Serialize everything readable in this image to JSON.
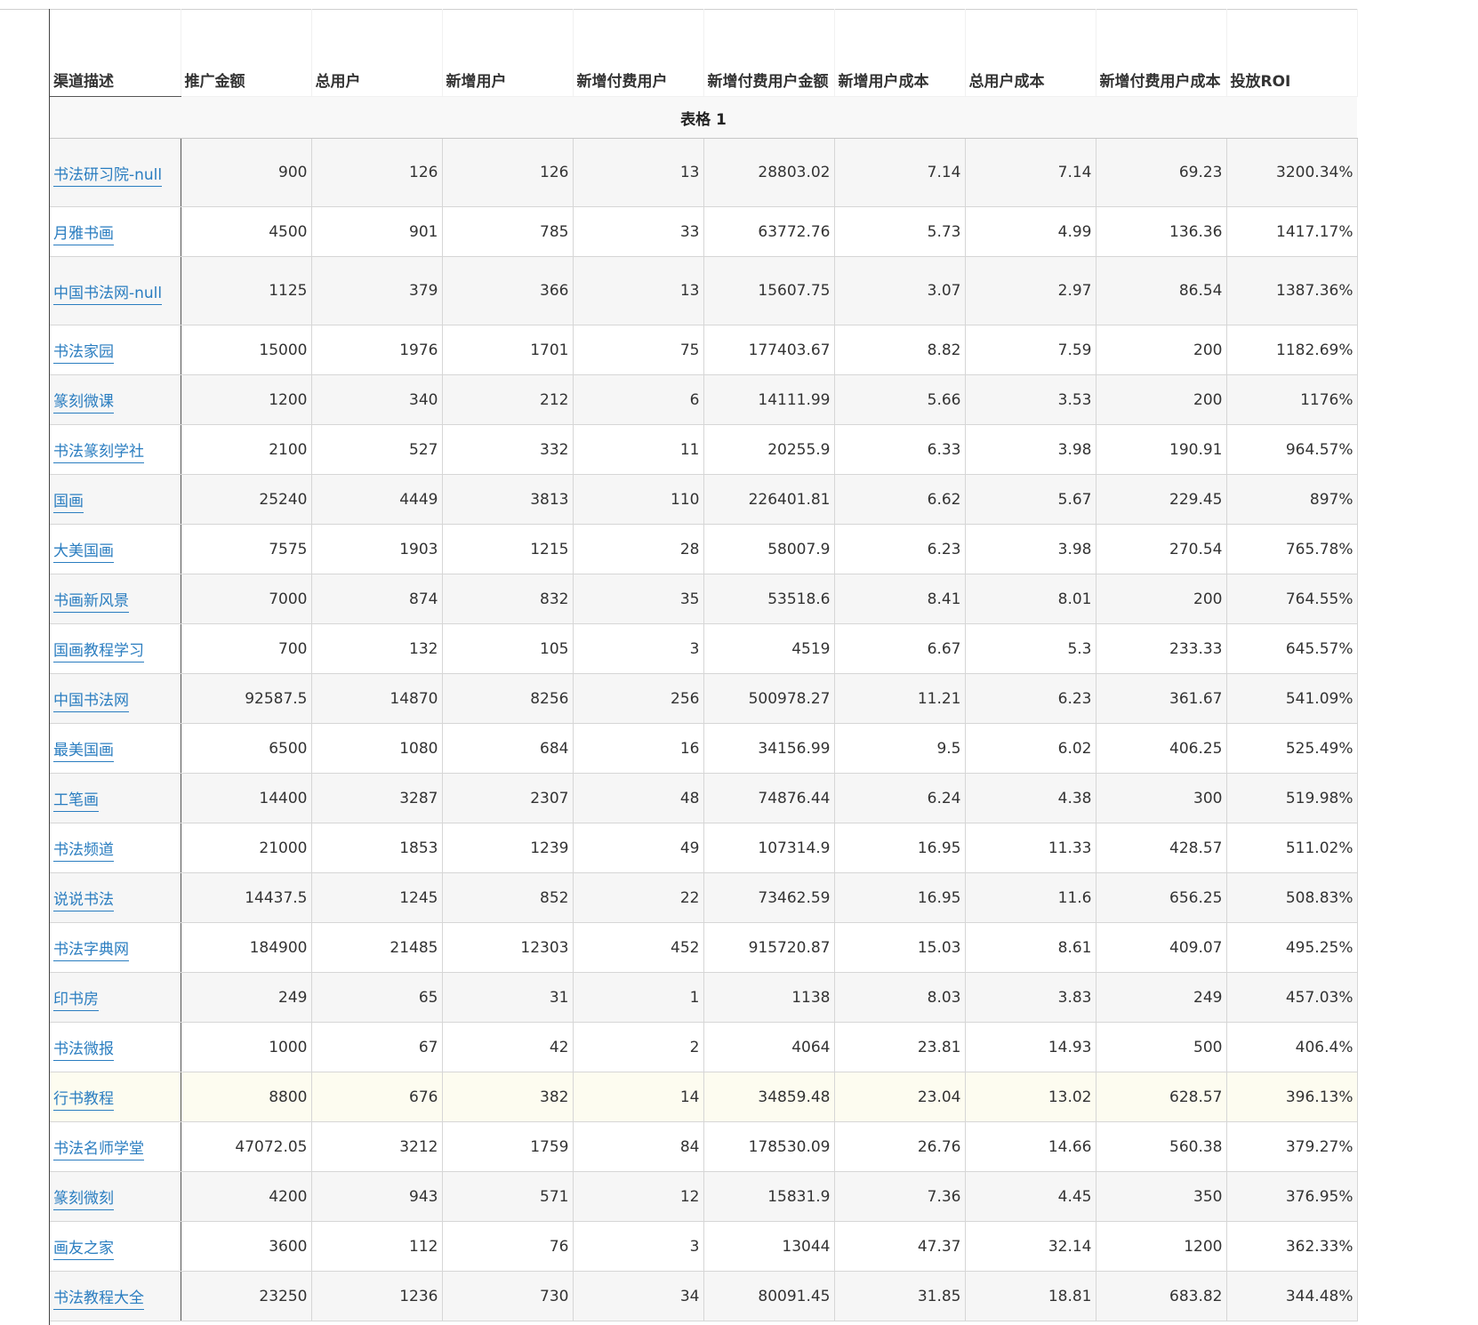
{
  "table": {
    "title": "表格 1",
    "headers": [
      "渠道描述",
      "推广金额",
      "总用户",
      "新增用户",
      "新增付费用户",
      "新增付费用户金额",
      "新增用户成本",
      "总用户成本",
      "新增付费用户成本",
      "投放ROI"
    ],
    "rows": [
      [
        "书法研习院-null",
        "900",
        "126",
        "126",
        "13",
        "28803.02",
        "7.14",
        "7.14",
        "69.23",
        "3200.34%"
      ],
      [
        "月雅书画",
        "4500",
        "901",
        "785",
        "33",
        "63772.76",
        "5.73",
        "4.99",
        "136.36",
        "1417.17%"
      ],
      [
        "中国书法网-null",
        "1125",
        "379",
        "366",
        "13",
        "15607.75",
        "3.07",
        "2.97",
        "86.54",
        "1387.36%"
      ],
      [
        "书法家园",
        "15000",
        "1976",
        "1701",
        "75",
        "177403.67",
        "8.82",
        "7.59",
        "200",
        "1182.69%"
      ],
      [
        "篆刻微课",
        "1200",
        "340",
        "212",
        "6",
        "14111.99",
        "5.66",
        "3.53",
        "200",
        "1176%"
      ],
      [
        "书法篆刻学社",
        "2100",
        "527",
        "332",
        "11",
        "20255.9",
        "6.33",
        "3.98",
        "190.91",
        "964.57%"
      ],
      [
        "国画",
        "25240",
        "4449",
        "3813",
        "110",
        "226401.81",
        "6.62",
        "5.67",
        "229.45",
        "897%"
      ],
      [
        "大美国画",
        "7575",
        "1903",
        "1215",
        "28",
        "58007.9",
        "6.23",
        "3.98",
        "270.54",
        "765.78%"
      ],
      [
        "书画新风景",
        "7000",
        "874",
        "832",
        "35",
        "53518.6",
        "8.41",
        "8.01",
        "200",
        "764.55%"
      ],
      [
        "国画教程学习",
        "700",
        "132",
        "105",
        "3",
        "4519",
        "6.67",
        "5.3",
        "233.33",
        "645.57%"
      ],
      [
        "中国书法网",
        "92587.5",
        "14870",
        "8256",
        "256",
        "500978.27",
        "11.21",
        "6.23",
        "361.67",
        "541.09%"
      ],
      [
        "最美国画",
        "6500",
        "1080",
        "684",
        "16",
        "34156.99",
        "9.5",
        "6.02",
        "406.25",
        "525.49%"
      ],
      [
        "工笔画",
        "14400",
        "3287",
        "2307",
        "48",
        "74876.44",
        "6.24",
        "4.38",
        "300",
        "519.98%"
      ],
      [
        "书法频道",
        "21000",
        "1853",
        "1239",
        "49",
        "107314.9",
        "16.95",
        "11.33",
        "428.57",
        "511.02%"
      ],
      [
        "说说书法",
        "14437.5",
        "1245",
        "852",
        "22",
        "73462.59",
        "16.95",
        "11.6",
        "656.25",
        "508.83%"
      ],
      [
        "书法字典网",
        "184900",
        "21485",
        "12303",
        "452",
        "915720.87",
        "15.03",
        "8.61",
        "409.07",
        "495.25%"
      ],
      [
        "印书房",
        "249",
        "65",
        "31",
        "1",
        "1138",
        "8.03",
        "3.83",
        "249",
        "457.03%"
      ],
      [
        "书法微报",
        "1000",
        "67",
        "42",
        "2",
        "4064",
        "23.81",
        "14.93",
        "500",
        "406.4%"
      ],
      [
        "行书教程",
        "8800",
        "676",
        "382",
        "14",
        "34859.48",
        "23.04",
        "13.02",
        "628.57",
        "396.13%"
      ],
      [
        "书法名师学堂",
        "47072.05",
        "3212",
        "1759",
        "84",
        "178530.09",
        "26.76",
        "14.66",
        "560.38",
        "379.27%"
      ],
      [
        "篆刻微刻",
        "4200",
        "943",
        "571",
        "12",
        "15831.9",
        "7.36",
        "4.45",
        "350",
        "376.95%"
      ],
      [
        "画友之家",
        "3600",
        "112",
        "76",
        "3",
        "13044",
        "47.37",
        "32.14",
        "1200",
        "362.33%"
      ],
      [
        "书法教程大全",
        "23250",
        "1236",
        "730",
        "34",
        "80091.45",
        "31.85",
        "18.81",
        "683.82",
        "344.48%"
      ]
    ]
  }
}
